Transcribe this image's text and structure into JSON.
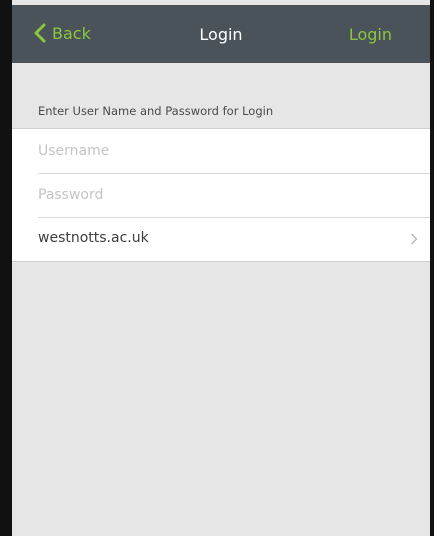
{
  "nav": {
    "back_label": "Back",
    "title": "Login",
    "login_label": "Login"
  },
  "form": {
    "header": "Enter User Name and Password for Login",
    "username": {
      "placeholder": "Username",
      "value": ""
    },
    "password": {
      "placeholder": "Password",
      "value": ""
    },
    "domain": {
      "value": "westnotts.ac.uk"
    }
  },
  "colors": {
    "accent": "#8cc63f",
    "navbar": "#4a525a",
    "background": "#e6e6e6"
  },
  "icons": {
    "back": "chevron-left-icon",
    "disclosure": "chevron-right-icon"
  }
}
